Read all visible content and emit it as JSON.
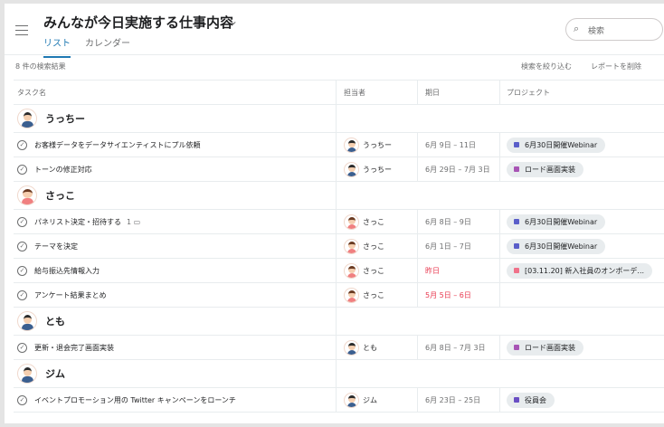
{
  "header": {
    "title": "みんなが今日実施する仕事内容",
    "tabs": [
      "リスト",
      "カレンダー"
    ],
    "search_placeholder": "検索"
  },
  "toolbar": {
    "result_count": "8 件の検索結果",
    "refine": "検索を絞り込む",
    "delete_report": "レポートを削除"
  },
  "columns": [
    "タスク名",
    "担当者",
    "期日",
    "プロジェクト"
  ],
  "colors": {
    "accent": "#1f79b3",
    "overdue": "#e8384f",
    "webinar": "#5a5ec9",
    "road": "#a855b5",
    "onboarding": "#f0728a",
    "board": "#6a4fc4"
  },
  "groups": [
    {
      "name": "うっちー",
      "gender": "m",
      "tasks": [
        {
          "name": "お客様データをデータサイエンティストにプル依頼",
          "assignee": "うっちー",
          "due": "6月 9日 – 11日",
          "overdue": false,
          "project": "6月30日開催Webinar",
          "color": "#5a5ec9"
        },
        {
          "name": "トーンの修正対応",
          "assignee": "うっちー",
          "due": "6月 29日 – 7月 3日",
          "overdue": false,
          "project": "ロード画面実装",
          "color": "#a855b5"
        }
      ]
    },
    {
      "name": "さっこ",
      "gender": "f",
      "tasks": [
        {
          "name": "パネリスト決定・招待する",
          "comments": "1",
          "assignee": "さっこ",
          "due": "6月 8日 – 9日",
          "overdue": false,
          "project": "6月30日開催Webinar",
          "color": "#5a5ec9"
        },
        {
          "name": "テーマを決定",
          "assignee": "さっこ",
          "due": "6月 1日 – 7日",
          "overdue": false,
          "project": "6月30日開催Webinar",
          "color": "#5a5ec9"
        },
        {
          "name": "給与振込先情報入力",
          "assignee": "さっこ",
          "due": "昨日",
          "overdue": true,
          "project": "[03.11.20] 新入社員のオンボーデ...",
          "color": "#f0728a"
        },
        {
          "name": "アンケート結果まとめ",
          "assignee": "さっこ",
          "due": "5月 5日 – 6日",
          "overdue": true,
          "project": "",
          "color": ""
        }
      ]
    },
    {
      "name": "とも",
      "gender": "m",
      "tasks": [
        {
          "name": "更新・退会完了画面実装",
          "assignee": "とも",
          "due": "6月 8日 – 7月 3日",
          "overdue": false,
          "project": "ロード画面実装",
          "color": "#a855b5"
        }
      ]
    },
    {
      "name": "ジム",
      "gender": "m",
      "tasks": [
        {
          "name": "イベントプロモーション用の Twitter キャンペーンをローンチ",
          "assignee": "ジム",
          "due": "6月 23日 – 25日",
          "overdue": false,
          "project": "役員会",
          "color": "#6a4fc4"
        }
      ]
    }
  ]
}
